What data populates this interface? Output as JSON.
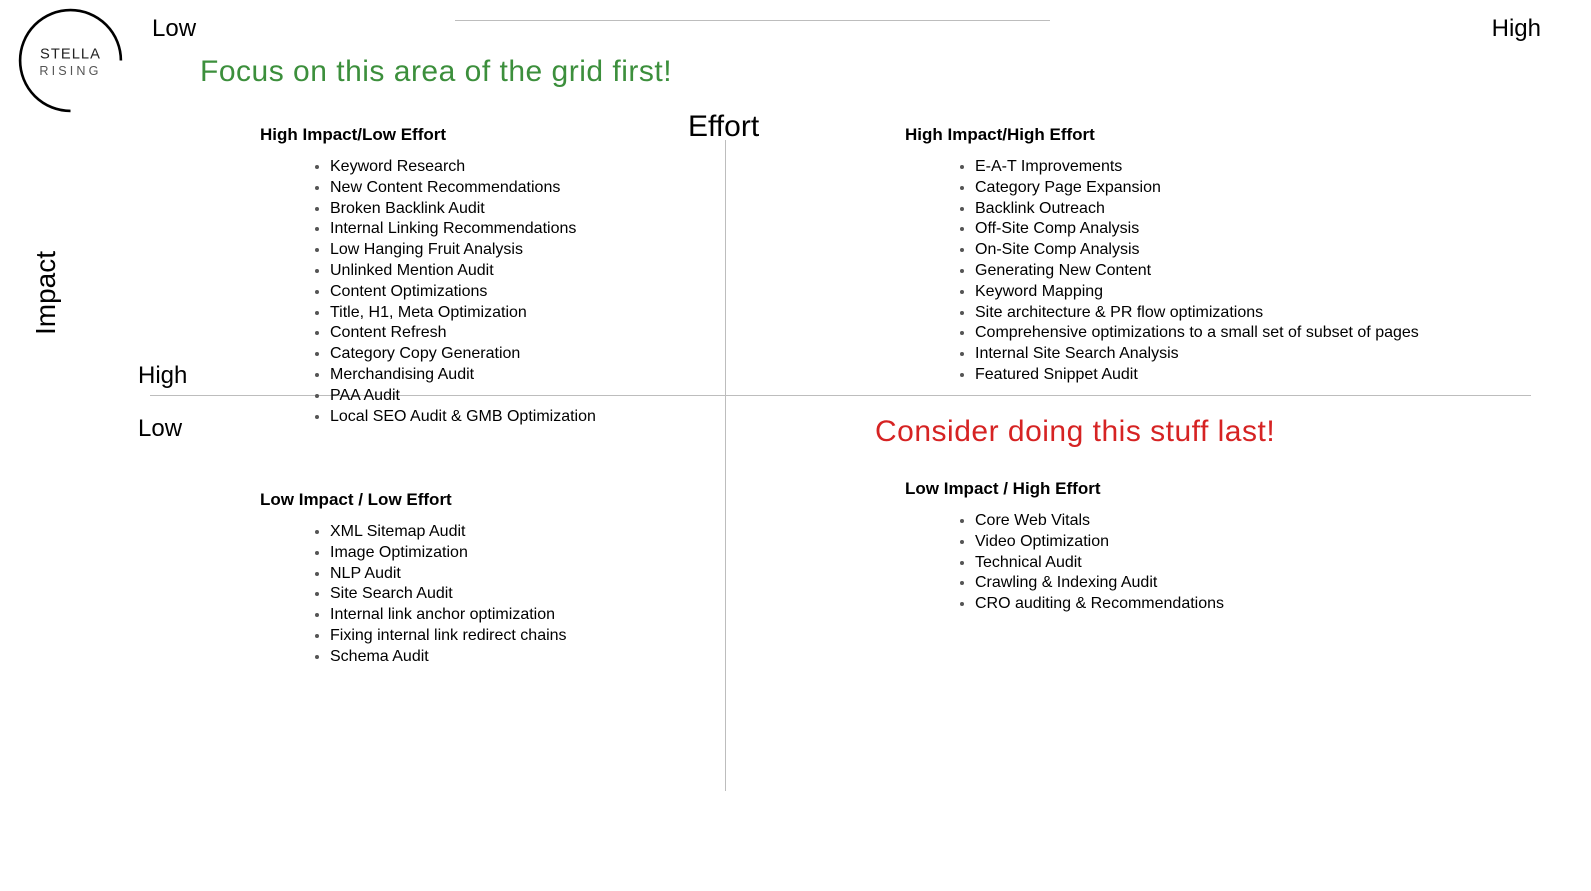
{
  "logo": {
    "top": "STELLA",
    "bottom": "RISING"
  },
  "axis": {
    "effort_low": "Low",
    "effort_high": "High",
    "effort_label": "Effort",
    "impact_label": "Impact",
    "impact_high": "High",
    "impact_low": "Low"
  },
  "callouts": {
    "focus": "Focus on this area of the grid first!",
    "last": "Consider doing this stuff last!"
  },
  "quadrants": {
    "tl": {
      "title": "High Impact/Low Effort",
      "items": [
        "Keyword Research",
        "New Content Recommendations",
        "Broken Backlink Audit",
        "Internal Linking Recommendations",
        "Low Hanging Fruit Analysis",
        "Unlinked Mention Audit",
        "Content Optimizations",
        "Title, H1, Meta Optimization",
        "Content Refresh",
        "Category Copy Generation",
        "Merchandising Audit",
        "PAA Audit",
        "Local SEO Audit & GMB Optimization"
      ]
    },
    "tr": {
      "title": "High Impact/High Effort",
      "items": [
        "E-A-T Improvements",
        "Category Page Expansion",
        "Backlink Outreach",
        "Off-Site Comp Analysis",
        "On-Site Comp Analysis",
        "Generating New Content",
        "Keyword Mapping",
        "Site architecture & PR flow optimizations",
        "Comprehensive optimizations to a small set of subset of pages",
        "Internal Site Search Analysis",
        "Featured Snippet Audit"
      ]
    },
    "bl": {
      "title": "Low Impact / Low Effort",
      "items": [
        "XML Sitemap Audit",
        "Image Optimization",
        "NLP Audit",
        "Site Search Audit",
        "Internal link anchor optimization",
        "Fixing internal link redirect chains",
        "Schema Audit"
      ]
    },
    "br": {
      "title": "Low Impact / High Effort",
      "items": [
        "Core Web Vitals",
        "Video Optimization",
        "Technical Audit",
        "Crawling & Indexing Audit",
        "CRO auditing & Recommendations"
      ]
    }
  }
}
